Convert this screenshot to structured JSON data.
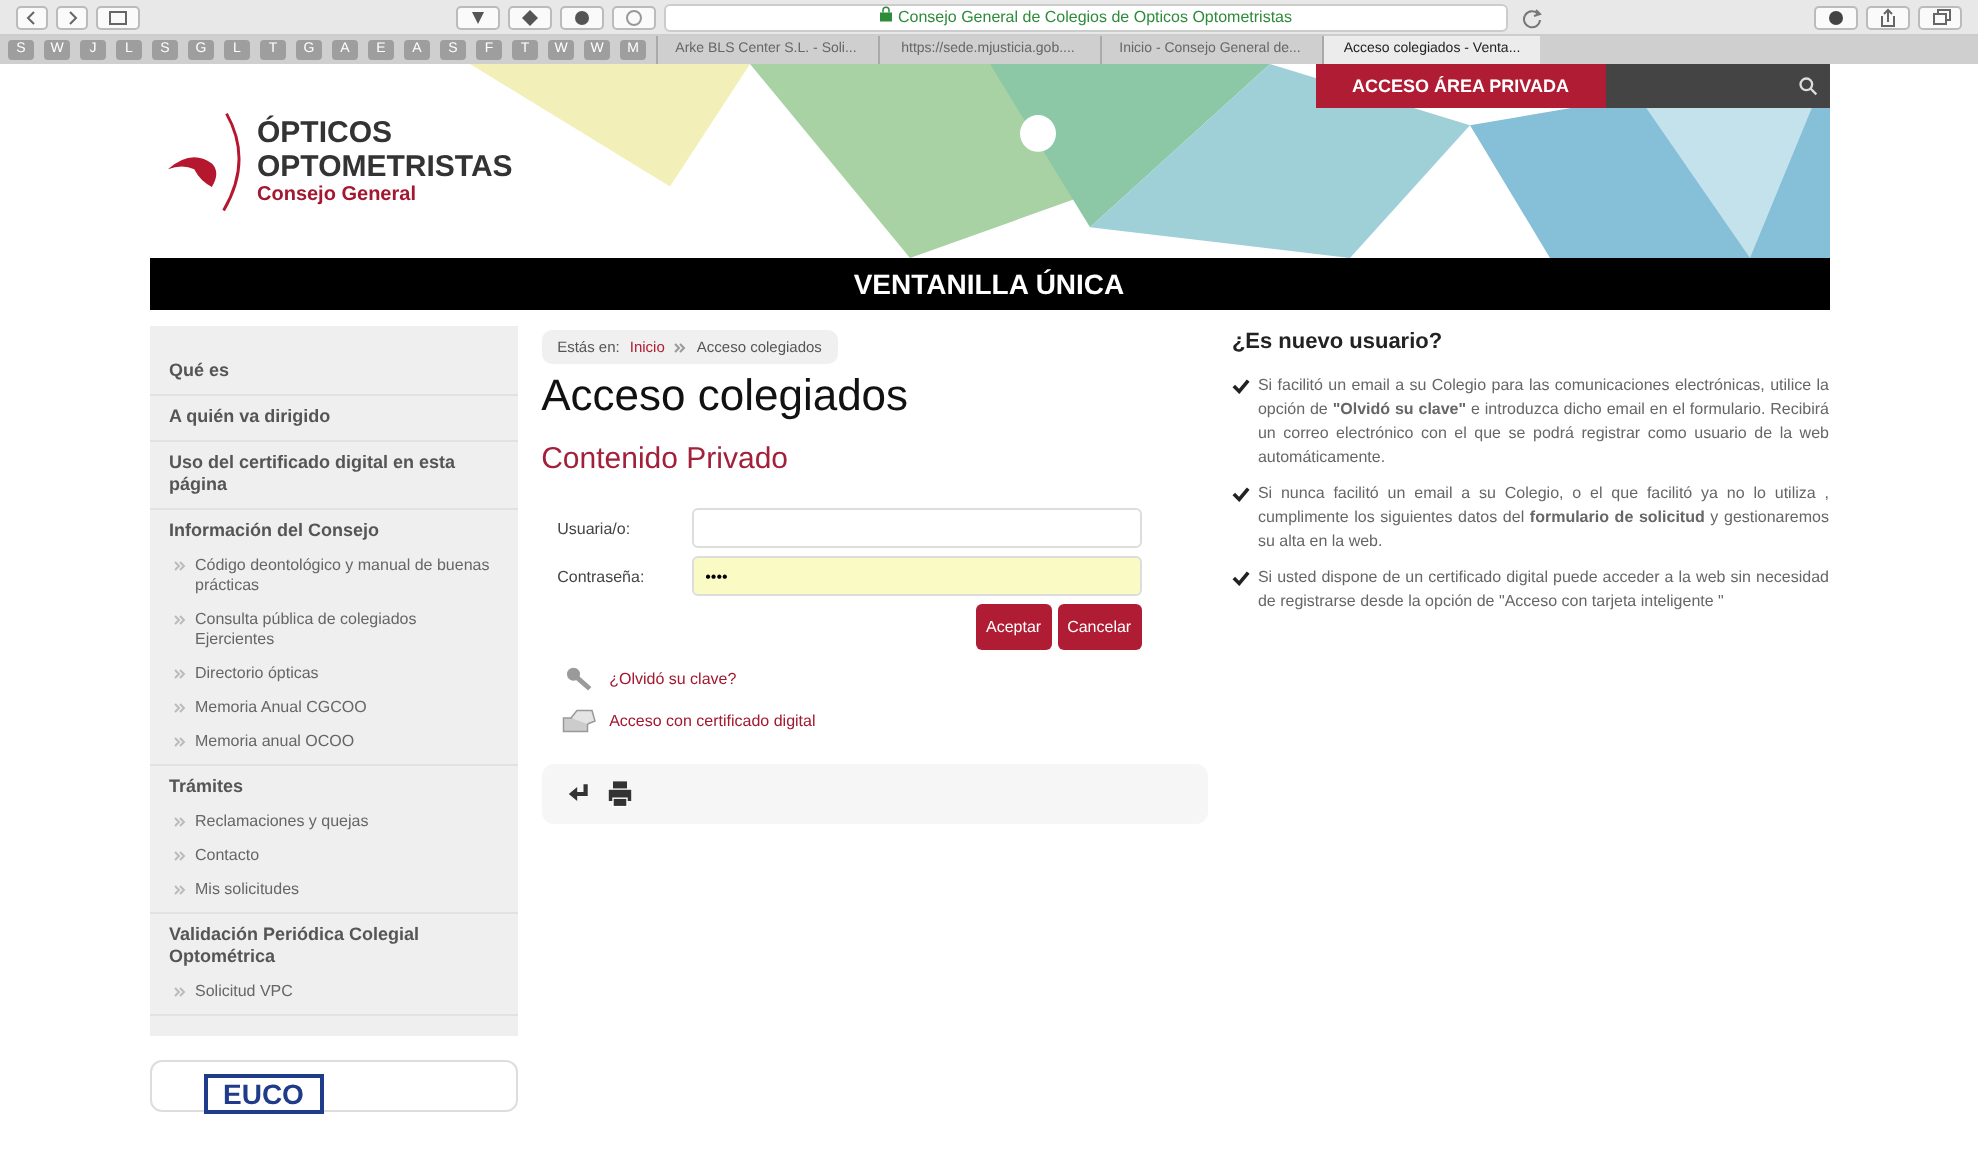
{
  "browser": {
    "address": "Consejo General de Colegios de Opticos Optometristas",
    "bookmarks": [
      "S",
      "W",
      "J",
      "L",
      "S",
      "G",
      "L",
      "T",
      "G",
      "A",
      "E",
      "A",
      "S",
      "F",
      "T",
      "W",
      "W",
      "M"
    ],
    "tabs": [
      {
        "label": "Arke BLS Center S.L. - Soli...",
        "selected": false
      },
      {
        "label": "https://sede.mjusticia.gob....",
        "selected": false
      },
      {
        "label": "Inicio - Consejo General de...",
        "selected": false
      },
      {
        "label": "Acceso colegiados - Venta...",
        "selected": true
      }
    ]
  },
  "header": {
    "logo_lines": [
      "ÓPTICOS",
      "OPTOMETRISTAS",
      "Consejo General"
    ],
    "private_access": "ACCESO ÁREA PRIVADA",
    "banner_title": "VENTANILLA ÚNICA"
  },
  "sidebar": {
    "sections": [
      {
        "label": "Qué es"
      },
      {
        "label": "A quién va dirigido"
      },
      {
        "label": "Uso del certificado digital en esta página"
      },
      {
        "label": "Información del Consejo",
        "children": [
          {
            "label": "Código deontológico y manual de buenas prácticas"
          },
          {
            "label": "Consulta pública de colegiados Ejercientes"
          },
          {
            "label": "Directorio ópticas"
          },
          {
            "label": "Memoria Anual CGCOO"
          },
          {
            "label": "Memoria anual OCOO"
          }
        ]
      },
      {
        "label": "Trámites",
        "children": [
          {
            "label": "Reclamaciones y quejas"
          },
          {
            "label": "Contacto"
          },
          {
            "label": "Mis solicitudes"
          }
        ]
      },
      {
        "label": "Validación Periódica Colegial Optométrica",
        "children": [
          {
            "label": "Solicitud VPC"
          }
        ]
      }
    ],
    "partner_logo": "EUCO"
  },
  "breadcrumb": {
    "prefix": "Estás en:",
    "items": [
      "Inicio",
      "Acceso colegiados"
    ]
  },
  "main": {
    "title": "Acceso colegiados",
    "subtitle": "Contenido Privado",
    "fields": [
      {
        "label": "Usuaria/o:",
        "autofilled": false
      },
      {
        "label": "Contraseña:",
        "value": "••••",
        "autofilled": true
      }
    ],
    "buttons": [
      "Aceptar",
      "Cancelar"
    ],
    "links": [
      {
        "kind": "key",
        "label": "¿Olvidó su clave?"
      },
      {
        "kind": "certificate",
        "label": "Acceso con certificado digital"
      }
    ]
  },
  "info": {
    "title": "¿Es nuevo usuario?",
    "items": [
      "Si facilitó un email a su Colegio para las comunicaciones electrónicas, utilice la opción de **\"Olvidó su clave\"** e introduzca dicho email en el formulario. Recibirá un correo electrónico con el que se podrá registrar como usuario de la web automáticamente.",
      "Si nunca facilitó un email a su Colegio, o el que facilitó ya no lo utiliza , cumplimente los siguientes datos del **formulario de solicitud** y gestionaremos su alta en la web.",
      "Si usted dispone de un certificado digital puede acceder a la web sin necesidad de registrarse desde la opción de \"Acceso con tarjeta inteligente \""
    ]
  }
}
